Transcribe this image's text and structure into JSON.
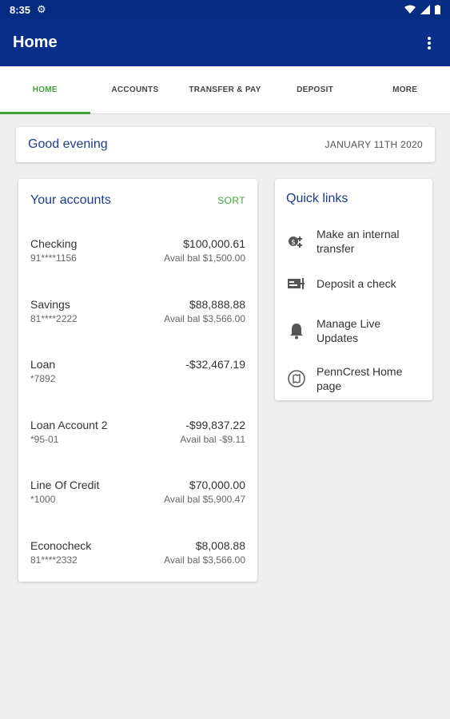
{
  "status_bar": {
    "time": "8:35"
  },
  "app_bar": {
    "title": "Home"
  },
  "tabs": [
    {
      "label": "HOME",
      "active": true
    },
    {
      "label": "ACCOUNTS"
    },
    {
      "label": "TRANSFER & PAY"
    },
    {
      "label": "DEPOSIT"
    },
    {
      "label": "MORE"
    }
  ],
  "greeting": {
    "text": "Good evening",
    "date": "JANUARY 11TH 2020"
  },
  "accounts": {
    "title": "Your accounts",
    "sort_label": "SORT",
    "items": [
      {
        "name": "Checking",
        "number": "91****1156",
        "balance": "$100,000.61",
        "avail": "Avail bal $1,500.00"
      },
      {
        "name": "Savings",
        "number": "81****2222",
        "balance": "$88,888.88",
        "avail": "Avail bal $3,566.00"
      },
      {
        "name": "Loan",
        "number": "*7892",
        "balance": "-$32,467.19",
        "avail": ""
      },
      {
        "name": "Loan Account 2",
        "number": "*95-01",
        "balance": "-$99,837.22",
        "avail": "Avail bal -$9.11"
      },
      {
        "name": "Line Of Credit",
        "number": "*1000",
        "balance": "$70,000.00",
        "avail": "Avail bal $5,900.47"
      },
      {
        "name": "Econocheck",
        "number": "81****2332",
        "balance": "$8,008.88",
        "avail": "Avail bal $3,566.00"
      }
    ]
  },
  "quick_links": {
    "title": "Quick links",
    "items": [
      {
        "label_line1": "Make an internal",
        "label_line2": "transfer",
        "icon": "transfer-icon"
      },
      {
        "label_line1": "Deposit a check",
        "label_line2": "",
        "icon": "check-icon"
      },
      {
        "label_line1": "Manage Live",
        "label_line2": "Updates",
        "icon": "bell-icon"
      },
      {
        "label_line1": "PennCrest Home",
        "label_line2": "page",
        "icon": "map-icon"
      }
    ]
  },
  "colors": {
    "primary": "#0a2f8a",
    "accent_green": "#3fa33a",
    "link_blue": "#1c3c8c"
  }
}
